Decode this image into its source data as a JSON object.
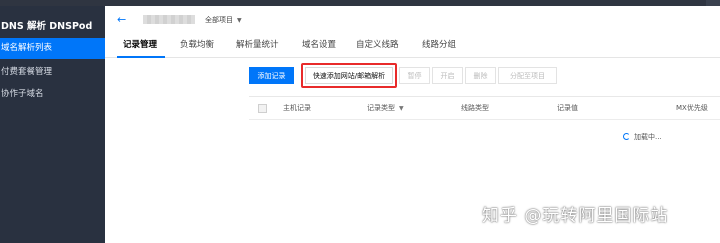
{
  "app": {
    "brand": "DNS 解析 DNSPod"
  },
  "sidebar": {
    "items": [
      {
        "label": "域名解析列表",
        "active": true
      },
      {
        "label": "付费套餐管理",
        "active": false
      },
      {
        "label": "协作子域名",
        "active": false
      }
    ]
  },
  "header": {
    "project_label": "全部项目"
  },
  "tabs": [
    {
      "label": "记录管理",
      "active": true
    },
    {
      "label": "负载均衡",
      "active": false
    },
    {
      "label": "解析量统计",
      "active": false
    },
    {
      "label": "域名设置",
      "active": false
    },
    {
      "label": "自定义线路",
      "active": false
    },
    {
      "label": "线路分组",
      "active": false
    }
  ],
  "toolbar": {
    "add_record": "添加记录",
    "quick_add": "快速添加网站/邮箱解析",
    "pause": "暂停",
    "enable": "开启",
    "delete": "删除",
    "assign_project": "分配至项目"
  },
  "table": {
    "columns": [
      "主机记录",
      "记录类型",
      "线路类型",
      "记录值",
      "MX优先级"
    ],
    "loading_text": "加载中..."
  },
  "watermark": "知乎 @玩转阿里国际站",
  "colors": {
    "accent": "#0076f9",
    "sidebar_bg": "#293140",
    "highlight": "#e82a2a"
  }
}
